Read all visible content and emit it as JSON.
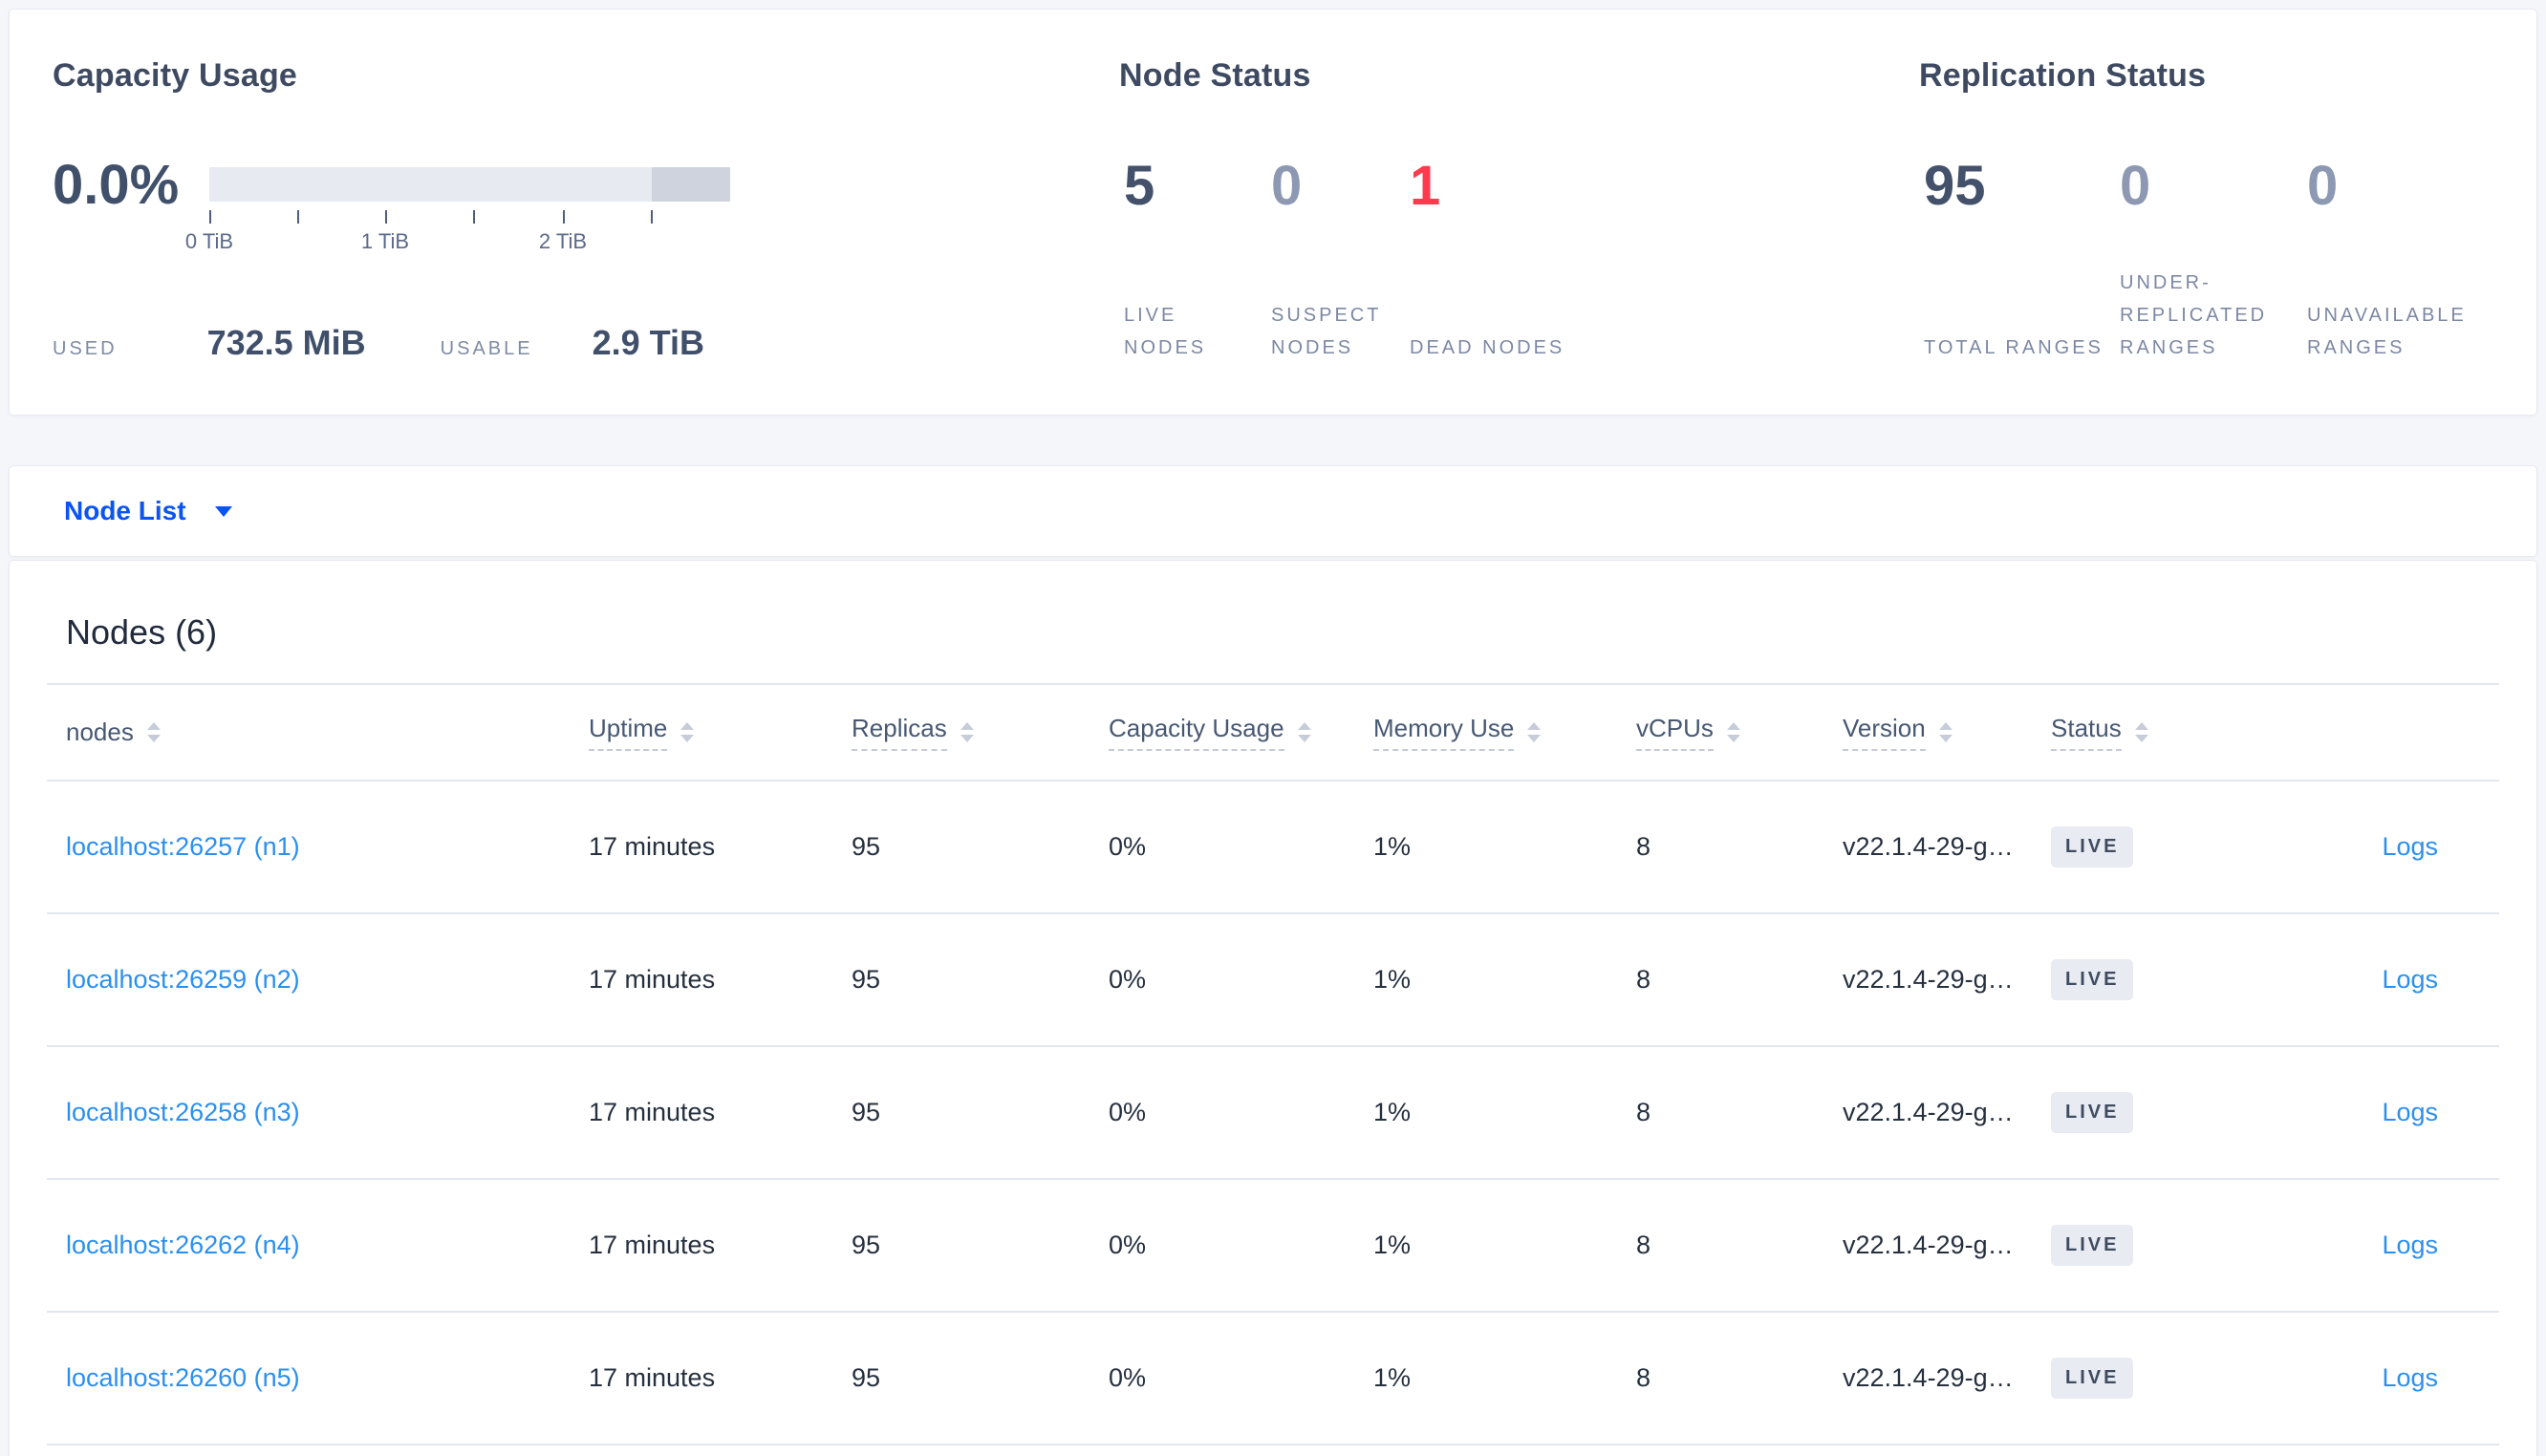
{
  "colors": {
    "accent_blue": "#0a53f5",
    "link_blue": "#2b8ff0",
    "dead_red": "#ff3a4e",
    "muted_number": "#8d99b3",
    "dark_number": "#44516b",
    "bar_light": "#e8eaf1",
    "bar_dark": "#ced3de",
    "badge_bg": "#e8ebf1"
  },
  "summary": {
    "capacity": {
      "title": "Capacity Usage",
      "percent": "0.0%",
      "axis_ticks": [
        "0 TiB",
        "1 TiB",
        "2 TiB"
      ],
      "used_label": "USED",
      "used_value": "732.5 MiB",
      "usable_label": "USABLE",
      "usable_value": "2.9 TiB"
    },
    "node_status": {
      "title": "Node Status",
      "stats": [
        {
          "value": "5",
          "label": "LIVE NODES"
        },
        {
          "value": "0",
          "label": "SUSPECT NODES"
        },
        {
          "value": "1",
          "label": "DEAD NODES"
        }
      ]
    },
    "replication_status": {
      "title": "Replication Status",
      "stats": [
        {
          "value": "95",
          "label": "TOTAL RANGES"
        },
        {
          "value": "0",
          "label": "UNDER-REPLICATED RANGES"
        },
        {
          "value": "0",
          "label": "UNAVAILABLE RANGES"
        }
      ]
    }
  },
  "view_selector": {
    "label": "Node List"
  },
  "table": {
    "title": "Nodes (6)",
    "columns": [
      "nodes",
      "Uptime",
      "Replicas",
      "Capacity Usage",
      "Memory Use",
      "vCPUs",
      "Version",
      "Status"
    ],
    "rows": [
      {
        "node": "localhost:26257 (n1)",
        "uptime": "17 minutes",
        "replicas": "95",
        "capacity": "0%",
        "memory": "1%",
        "vcpus": "8",
        "version": "v22.1.4-29-g…",
        "status": "LIVE",
        "logs": "Logs"
      },
      {
        "node": "localhost:26259 (n2)",
        "uptime": "17 minutes",
        "replicas": "95",
        "capacity": "0%",
        "memory": "1%",
        "vcpus": "8",
        "version": "v22.1.4-29-g…",
        "status": "LIVE",
        "logs": "Logs"
      },
      {
        "node": "localhost:26258 (n3)",
        "uptime": "17 minutes",
        "replicas": "95",
        "capacity": "0%",
        "memory": "1%",
        "vcpus": "8",
        "version": "v22.1.4-29-g…",
        "status": "LIVE",
        "logs": "Logs"
      },
      {
        "node": "localhost:26262 (n4)",
        "uptime": "17 minutes",
        "replicas": "95",
        "capacity": "0%",
        "memory": "1%",
        "vcpus": "8",
        "version": "v22.1.4-29-g…",
        "status": "LIVE",
        "logs": "Logs"
      },
      {
        "node": "localhost:26260 (n5)",
        "uptime": "17 minutes",
        "replicas": "95",
        "capacity": "0%",
        "memory": "1%",
        "vcpus": "8",
        "version": "v22.1.4-29-g…",
        "status": "LIVE",
        "logs": "Logs"
      }
    ]
  }
}
